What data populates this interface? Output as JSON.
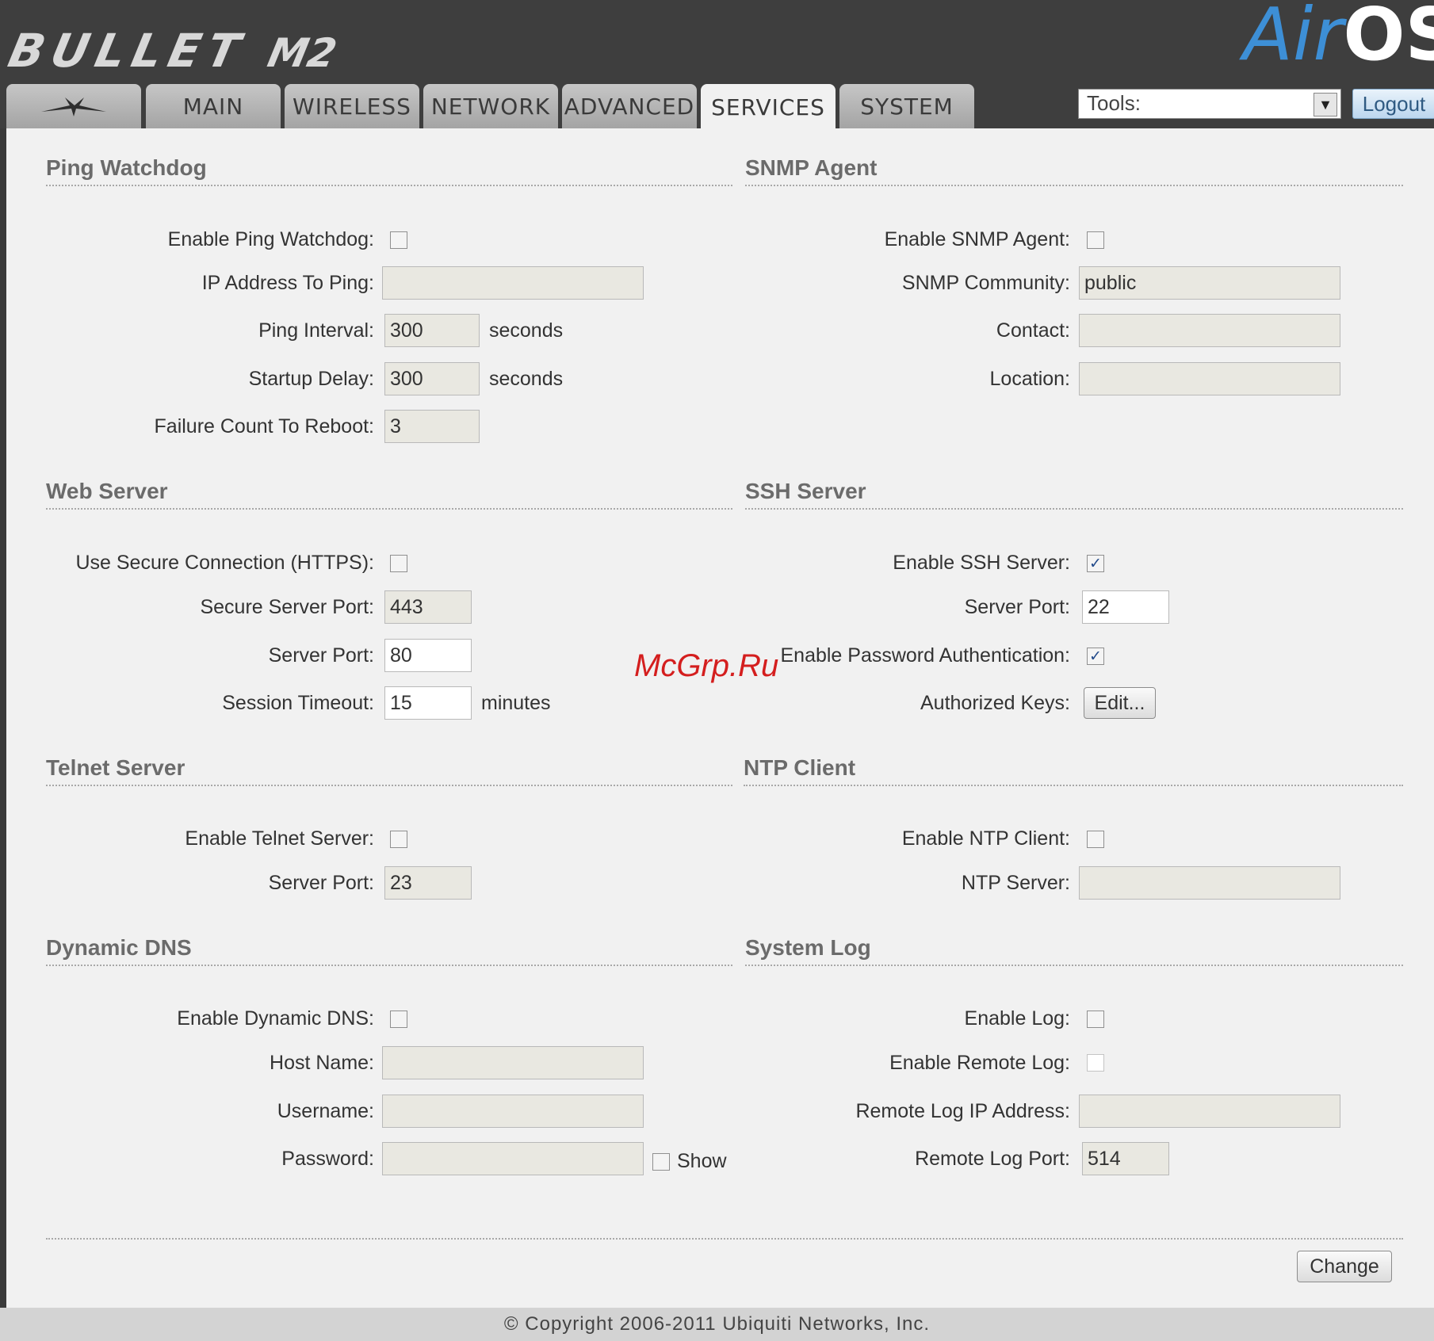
{
  "header": {
    "brand": "BULLET",
    "brand_model": "M2",
    "logo_air": "Air",
    "logo_os": "OS"
  },
  "tabs": [
    {
      "label": "",
      "icon": "ubiquiti-logo-icon"
    },
    {
      "label": "MAIN"
    },
    {
      "label": "WIRELESS"
    },
    {
      "label": "NETWORK"
    },
    {
      "label": "ADVANCED"
    },
    {
      "label": "SERVICES",
      "active": true
    },
    {
      "label": "SYSTEM"
    }
  ],
  "tools": {
    "label": "Tools:"
  },
  "logout_label": "Logout",
  "ping_watchdog": {
    "title": "Ping Watchdog",
    "enable_label": "Enable Ping Watchdog:",
    "enable_checked": false,
    "ip_label": "IP Address To Ping:",
    "ip_value": "",
    "interval_label": "Ping Interval:",
    "interval_value": "300",
    "interval_unit": "seconds",
    "delay_label": "Startup Delay:",
    "delay_value": "300",
    "delay_unit": "seconds",
    "failure_label": "Failure Count To Reboot:",
    "failure_value": "3"
  },
  "snmp": {
    "title": "SNMP Agent",
    "enable_label": "Enable SNMP Agent:",
    "enable_checked": false,
    "community_label": "SNMP Community:",
    "community_value": "public",
    "contact_label": "Contact:",
    "contact_value": "",
    "location_label": "Location:",
    "location_value": ""
  },
  "web_server": {
    "title": "Web Server",
    "https_label": "Use Secure Connection (HTTPS):",
    "https_checked": false,
    "secure_port_label": "Secure Server Port:",
    "secure_port_value": "443",
    "port_label": "Server Port:",
    "port_value": "80",
    "timeout_label": "Session Timeout:",
    "timeout_value": "15",
    "timeout_unit": "minutes"
  },
  "ssh": {
    "title": "SSH Server",
    "enable_label": "Enable SSH Server:",
    "enable_checked": true,
    "port_label": "Server Port:",
    "port_value": "22",
    "pass_label": "Enable Password Authentication:",
    "pass_checked": true,
    "keys_label": "Authorized Keys:",
    "keys_button": "Edit..."
  },
  "telnet": {
    "title": "Telnet Server",
    "enable_label": "Enable Telnet Server:",
    "enable_checked": false,
    "port_label": "Server Port:",
    "port_value": "23"
  },
  "ntp": {
    "title": "NTP Client",
    "enable_label": "Enable NTP Client:",
    "enable_checked": false,
    "server_label": "NTP Server:",
    "server_value": ""
  },
  "ddns": {
    "title": "Dynamic DNS",
    "enable_label": "Enable Dynamic DNS:",
    "enable_checked": false,
    "host_label": "Host Name:",
    "host_value": "",
    "user_label": "Username:",
    "user_value": "",
    "pass_label": "Password:",
    "pass_value": "",
    "show_label": "Show"
  },
  "syslog": {
    "title": "System Log",
    "enable_label": "Enable Log:",
    "enable_checked": false,
    "remote_label": "Enable Remote Log:",
    "remote_checked": false,
    "ip_label": "Remote Log IP Address:",
    "ip_value": "",
    "port_label": "Remote Log Port:",
    "port_value": "514"
  },
  "change_button": "Change",
  "footer": "© Copyright 2006-2011 Ubiquiti Networks, Inc.",
  "watermark": "McGrp.Ru",
  "colors": {
    "accent_blue": "#3d8fd6",
    "header_bg": "#3e3e3e",
    "content_bg": "#f1f1f1"
  }
}
